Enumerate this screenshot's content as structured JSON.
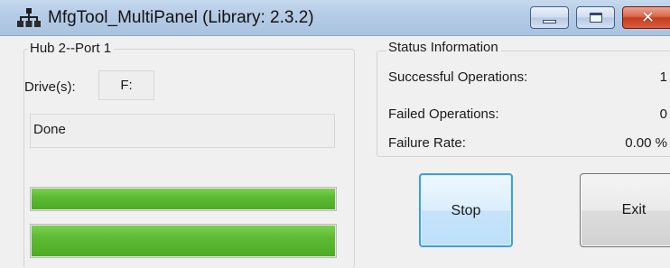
{
  "window": {
    "title": "MfgTool_MultiPanel (Library: 2.3.2)",
    "icon": "network-hub-icon",
    "controls": {
      "minimize": "minimize-icon",
      "maximize": "maximize-icon",
      "close_glyph": "✕"
    }
  },
  "hub_panel": {
    "title": "Hub 2--Port 1",
    "drive_label": "Drive(s):",
    "drive_value": "F:",
    "status_text": "Done",
    "progress_bars": [
      {
        "name": "operation-progress",
        "fraction": 1.0
      },
      {
        "name": "overall-progress",
        "fraction": 1.0
      }
    ]
  },
  "status_info": {
    "title": "Status Information",
    "rows": [
      {
        "label": "Successful Operations:",
        "value": "1"
      },
      {
        "label": "Failed Operations:",
        "value": "0"
      },
      {
        "label": "Failure Rate:",
        "value": "0.00 %"
      }
    ]
  },
  "buttons": {
    "stop": "Stop",
    "exit": "Exit"
  },
  "colors": {
    "progress_fill": "#5dbb34",
    "stop_button_border": "#3c9fe0",
    "close_button": "#c43d20",
    "titlebar": "#b4cbe5"
  }
}
